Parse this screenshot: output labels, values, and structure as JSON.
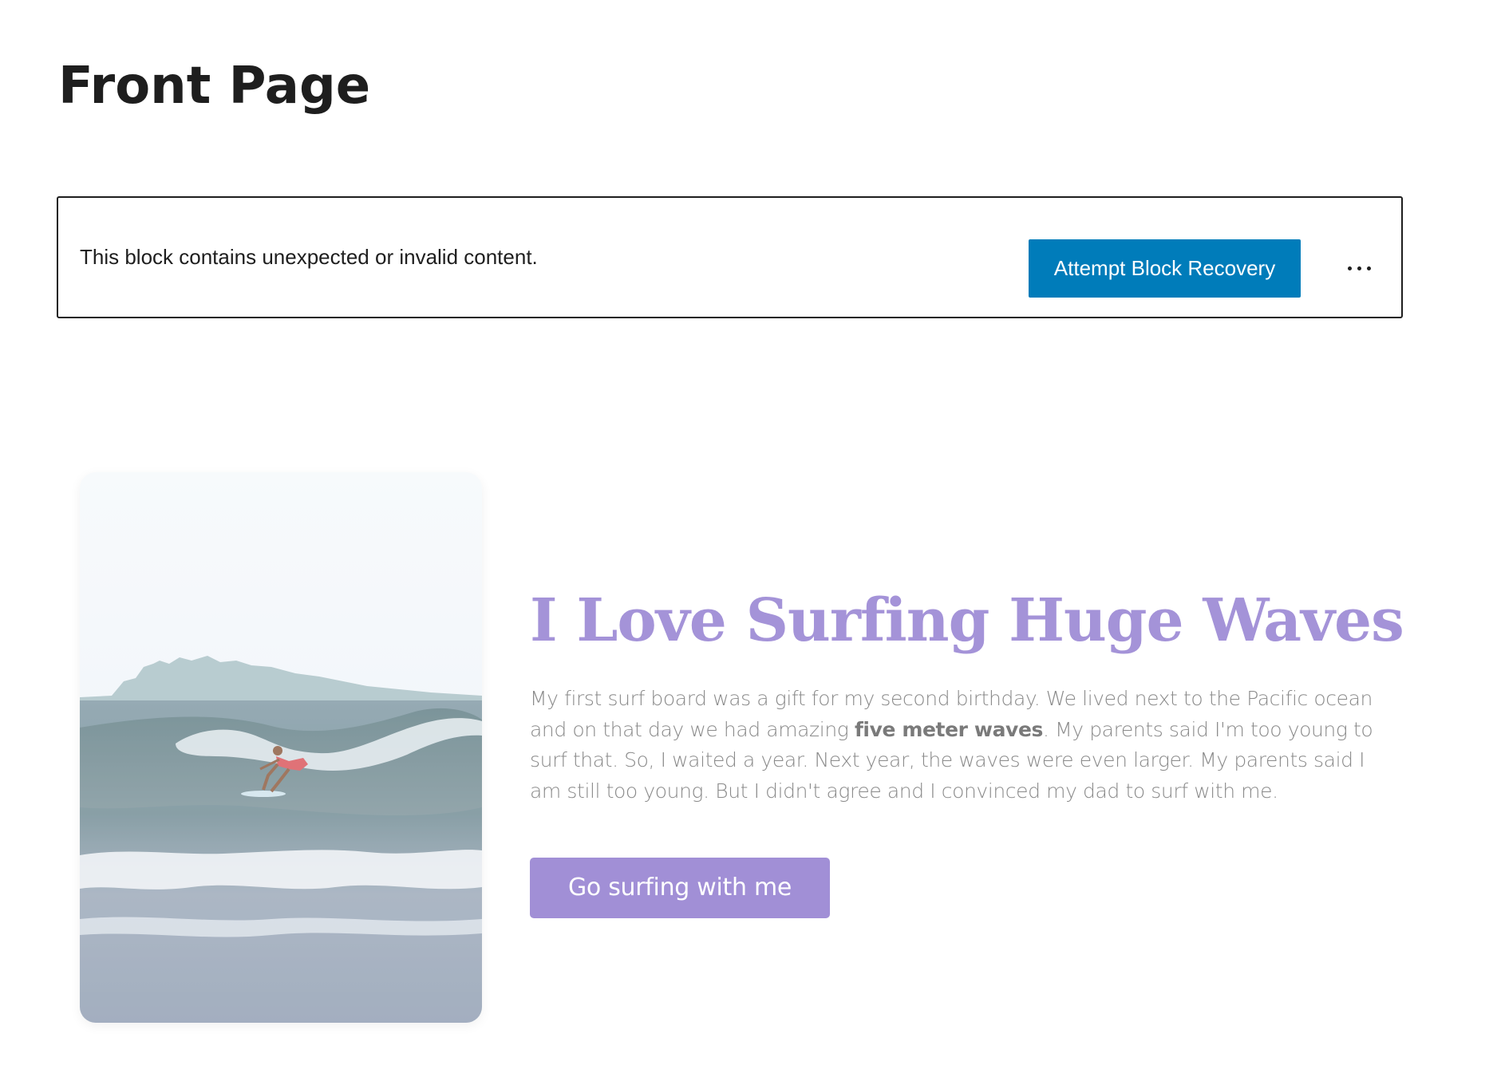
{
  "page": {
    "title": "Front Page"
  },
  "block_warning": {
    "message": "This block contains unexpected or invalid content.",
    "recovery_label": "Attempt Block Recovery",
    "more_icon": "more-horizontal-icon",
    "accent_color": "#007cba"
  },
  "hero": {
    "image_subject": "surfer riding a wave",
    "heading": "I Love Surfing Huge Waves",
    "paragraph": {
      "before": "My first surf board was a gift for my second birthday. We lived next to the Pacific ocean and on that day we had amazing ",
      "bold": "five meter waves",
      "after": ". My parents said I'm too young to surf that. So, I waited a year. Next year, the waves were even larger. My parents said I am still too young. But I didn't agree and I convinced my dad to surf with me."
    },
    "cta_label": "Go surfing with me",
    "accent_color": "#a493d8"
  }
}
